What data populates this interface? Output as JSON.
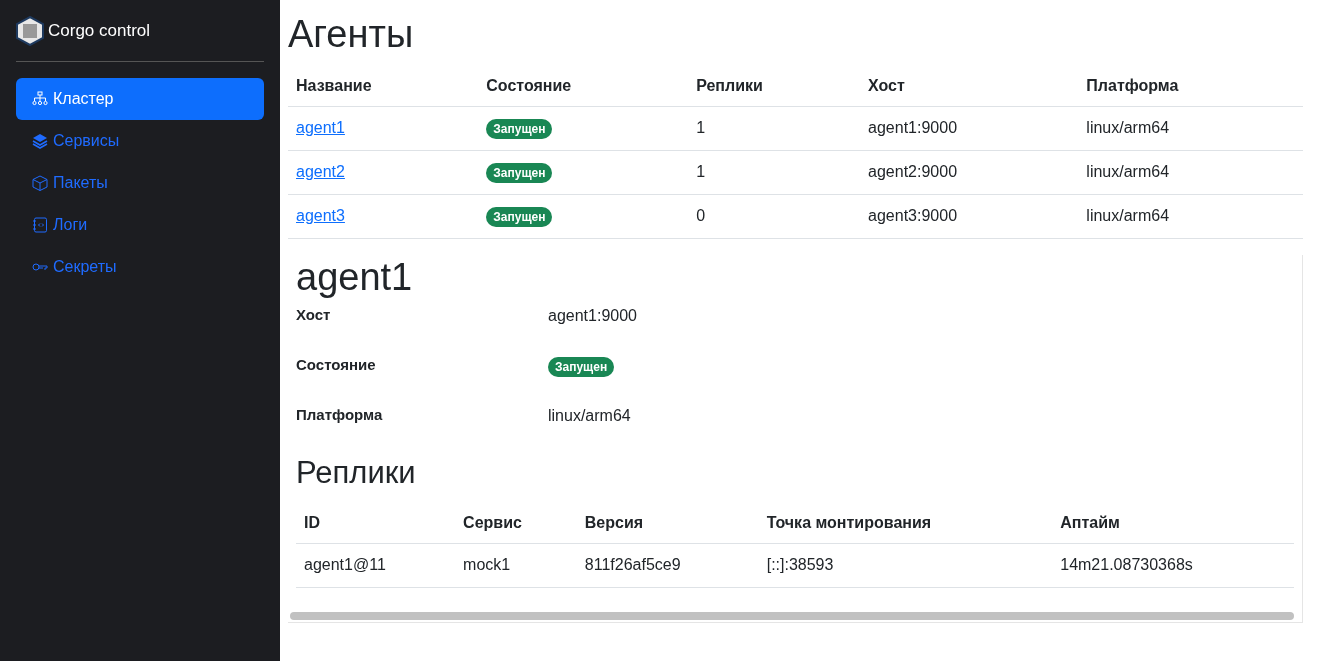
{
  "sidebar": {
    "brand": "Corgo control",
    "items": [
      {
        "label": "Кластер",
        "selected": true
      },
      {
        "label": "Сервисы",
        "selected": false
      },
      {
        "label": "Пакеты",
        "selected": false
      },
      {
        "label": "Логи",
        "selected": false
      },
      {
        "label": "Секреты",
        "selected": false
      }
    ]
  },
  "title": "Агенты",
  "agents_table": {
    "columns": [
      "Название",
      "Состояние",
      "Реплики",
      "Хост",
      "Платформа"
    ],
    "rows": [
      {
        "name": "agent1",
        "state": "Запущен",
        "replicas": "1",
        "host": "agent1:9000",
        "platform": "linux/arm64"
      },
      {
        "name": "agent2",
        "state": "Запущен",
        "replicas": "1",
        "host": "agent2:9000",
        "platform": "linux/arm64"
      },
      {
        "name": "agent3",
        "state": "Запущен",
        "replicas": "0",
        "host": "agent3:9000",
        "platform": "linux/arm64"
      }
    ]
  },
  "detail": {
    "title": "agent1",
    "fields": [
      {
        "label": "Хост",
        "value": "agent1:9000",
        "kind": "text"
      },
      {
        "label": "Состояние",
        "value": "Запущен",
        "kind": "badge"
      },
      {
        "label": "Платформа",
        "value": "linux/arm64",
        "kind": "text"
      }
    ],
    "replicas_title": "Реплики",
    "replicas_table": {
      "columns": [
        "ID",
        "Сервис",
        "Версия",
        "Точка монтирования",
        "Аптайм"
      ],
      "rows": [
        [
          "agent1@11",
          "mock1",
          "811f26af5ce9",
          "[::]:38593",
          "14m21.08730368s"
        ]
      ]
    }
  }
}
